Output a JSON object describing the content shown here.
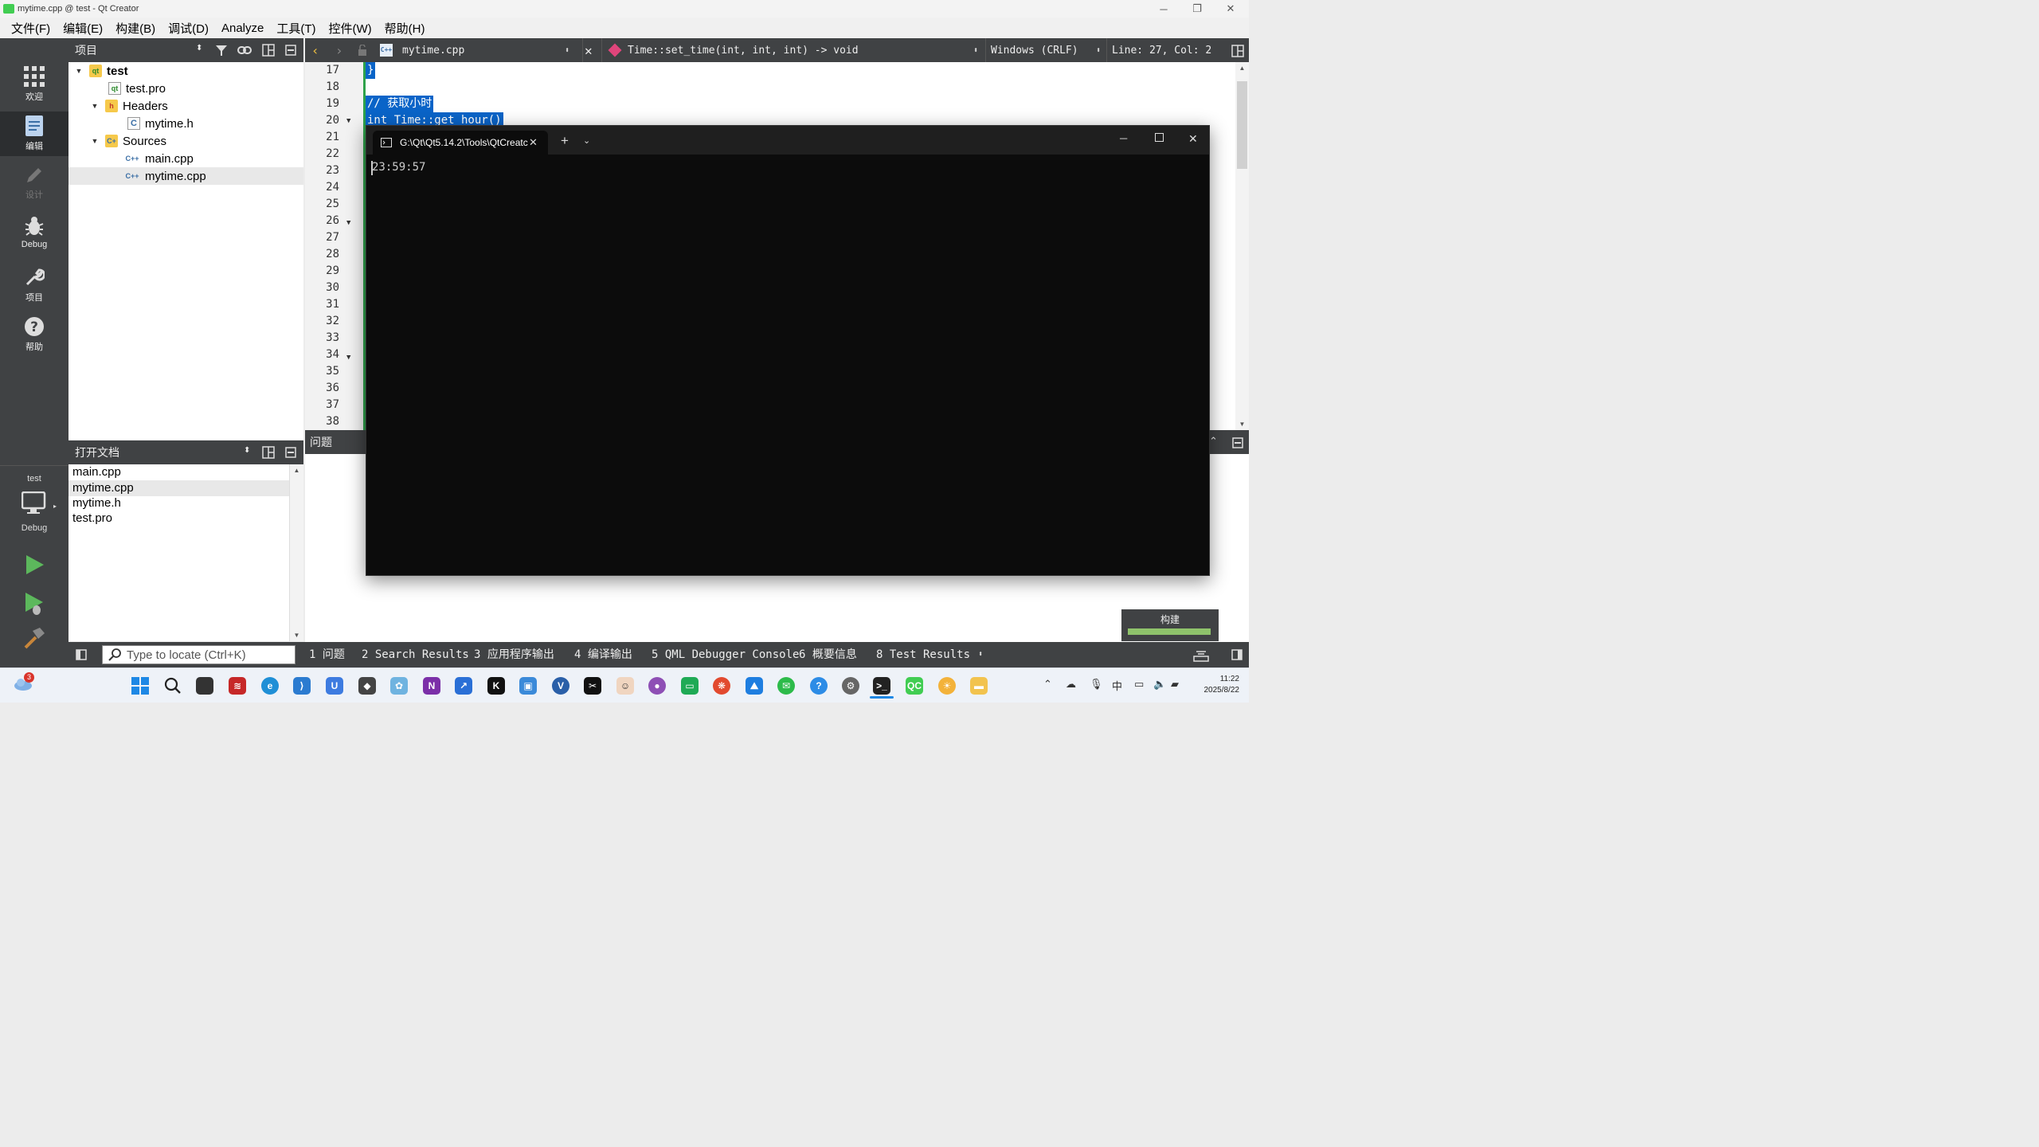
{
  "window": {
    "title": "mytime.cpp @ test - Qt Creator"
  },
  "menu": [
    "文件(F)",
    "编辑(E)",
    "构建(B)",
    "调试(D)",
    "Analyze",
    "工具(T)",
    "控件(W)",
    "帮助(H)"
  ],
  "modes": [
    {
      "label": "欢迎",
      "icon": "grid-icon"
    },
    {
      "label": "编辑",
      "icon": "edit-doc-icon"
    },
    {
      "label": "设计",
      "icon": "pencil-icon"
    },
    {
      "label": "Debug",
      "icon": "bug-icon"
    },
    {
      "label": "项目",
      "icon": "wrench-icon"
    },
    {
      "label": "帮助",
      "icon": "help-icon"
    }
  ],
  "kit": {
    "project": "test",
    "build": "Debug"
  },
  "project_panel": {
    "title": "项目",
    "tree": [
      {
        "label": "test",
        "level": 0,
        "type": "project"
      },
      {
        "label": "test.pro",
        "level": 1,
        "type": "pro"
      },
      {
        "label": "Headers",
        "level": 1,
        "type": "folder-h"
      },
      {
        "label": "mytime.h",
        "level": 2,
        "type": "header"
      },
      {
        "label": "Sources",
        "level": 1,
        "type": "folder-cpp"
      },
      {
        "label": "main.cpp",
        "level": 2,
        "type": "cpp"
      },
      {
        "label": "mytime.cpp",
        "level": 2,
        "type": "cpp",
        "selected": true
      }
    ]
  },
  "open_docs": {
    "title": "打开文档",
    "items": [
      "main.cpp",
      "mytime.cpp",
      "mytime.h",
      "test.pro"
    ],
    "selected": "mytime.cpp"
  },
  "editor": {
    "file": "mytime.cpp",
    "symbol": "Time::set_time(int, int, int) -> void",
    "line_ending": "Windows (CRLF)",
    "position": "Line: 27, Col: 2",
    "line_numbers": [
      "17",
      "18",
      "19",
      "20",
      "21",
      "22",
      "23",
      "24",
      "25",
      "26",
      "27",
      "28",
      "29",
      "30",
      "31",
      "32",
      "33",
      "34",
      "35",
      "36",
      "37",
      "38"
    ],
    "visible_code": [
      "}",
      "// 获取小时",
      "int Time::get_hour()"
    ]
  },
  "output_pane": {
    "title": "问题"
  },
  "build": {
    "label": "构建",
    "progress": 1.0
  },
  "locator": {
    "placeholder": "Type to locate (Ctrl+K)"
  },
  "pane_tabs": [
    "1 问题",
    "2 Search Results",
    "3 应用程序输出",
    "4 编译输出",
    "5 QML Debugger Console",
    "6 概要信息",
    "8 Test Results"
  ],
  "terminal": {
    "tab_title": "G:\\Qt\\Qt5.14.2\\Tools\\QtCreatc",
    "output": "23:59:57"
  },
  "taskbar": {
    "notification_badge": "3",
    "tray_ime": "中",
    "time": "11:22",
    "date": "2025/8/22"
  },
  "colors": {
    "selection": "#0a64c8",
    "modebar": "#404244",
    "run": "#5cb85c"
  }
}
